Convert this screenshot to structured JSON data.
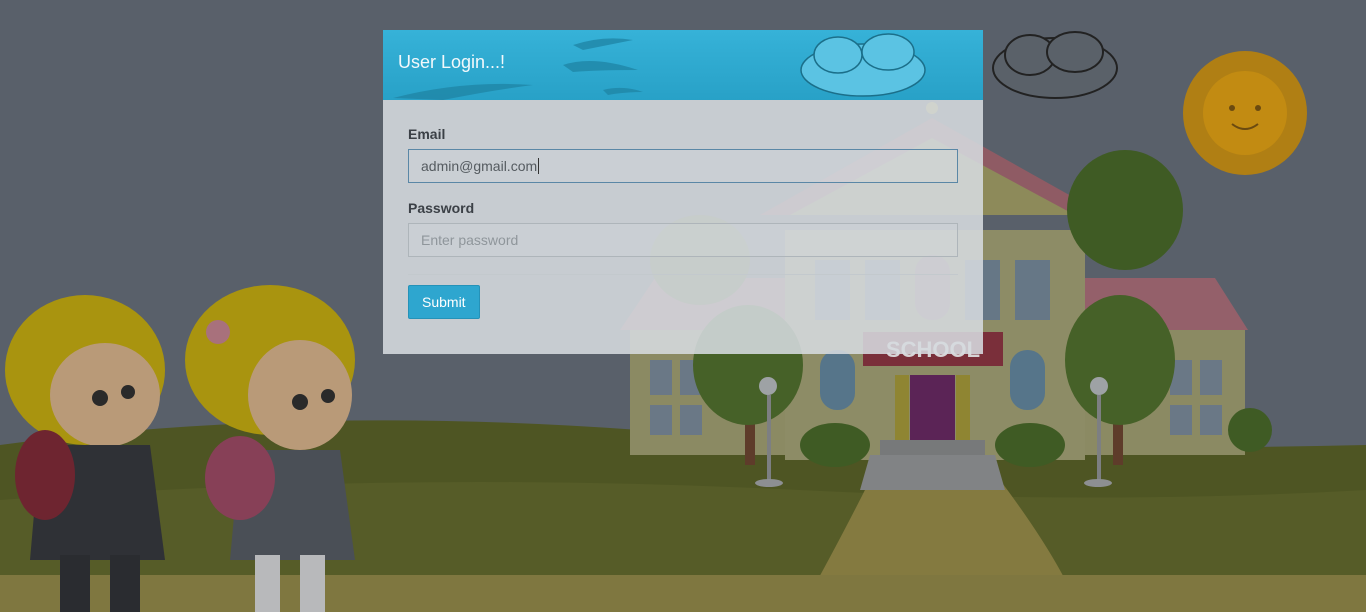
{
  "login": {
    "title": "User Login...!",
    "email_label": "Email",
    "email_value": "admin@gmail.com",
    "password_label": "Password",
    "password_placeholder": "Enter password",
    "submit_label": "Submit"
  },
  "background": {
    "building_sign": "SCHOOL"
  },
  "colors": {
    "header": "#2ea6cf",
    "overlay": "#59606a",
    "grass": "#4d5322",
    "path": "#847a40"
  }
}
